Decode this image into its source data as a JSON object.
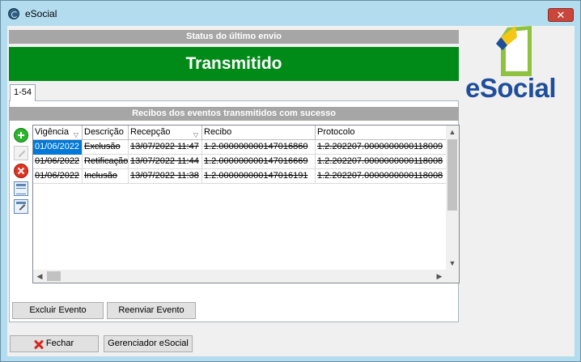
{
  "window": {
    "title": "eSocial",
    "close_icon": "close-icon"
  },
  "status": {
    "header": "Status do último envio",
    "value": "Transmitido",
    "color": "#008a17"
  },
  "logo": {
    "text": "eSocial"
  },
  "tabs": [
    {
      "label": "1-54"
    }
  ],
  "receipts": {
    "header": "Recibos dos eventos transmitidos com sucesso",
    "columns": [
      "Vigência",
      "Descrição",
      "Recepção",
      "Recibo",
      "Protocolo"
    ],
    "rows": [
      [
        "01/06/2022",
        "Exclusão",
        "13/07/2022 11:47",
        "1.2.0000000001470168​60",
        "1.2.202207.0000000000118009"
      ],
      [
        "01/06/2022",
        "Retificação",
        "13/07/2022 11:44",
        "1.2.0000000001470166​69",
        "1.2.202207.0000000000118008"
      ],
      [
        "01/06/2022",
        "Inclusão",
        "13/07/2022 11:38",
        "1.2.0000000001470161​91",
        "1.2.202207.0000000000118008"
      ]
    ]
  },
  "tools": [
    "add-icon",
    "edit-icon",
    "delete-icon",
    "columns-icon",
    "form-icon"
  ],
  "buttons": {
    "excluir": "Excluir Evento",
    "reenviar": "Reenviar Evento",
    "fechar": "Fechar",
    "gerenciador": "Gerenciador eSocial"
  }
}
